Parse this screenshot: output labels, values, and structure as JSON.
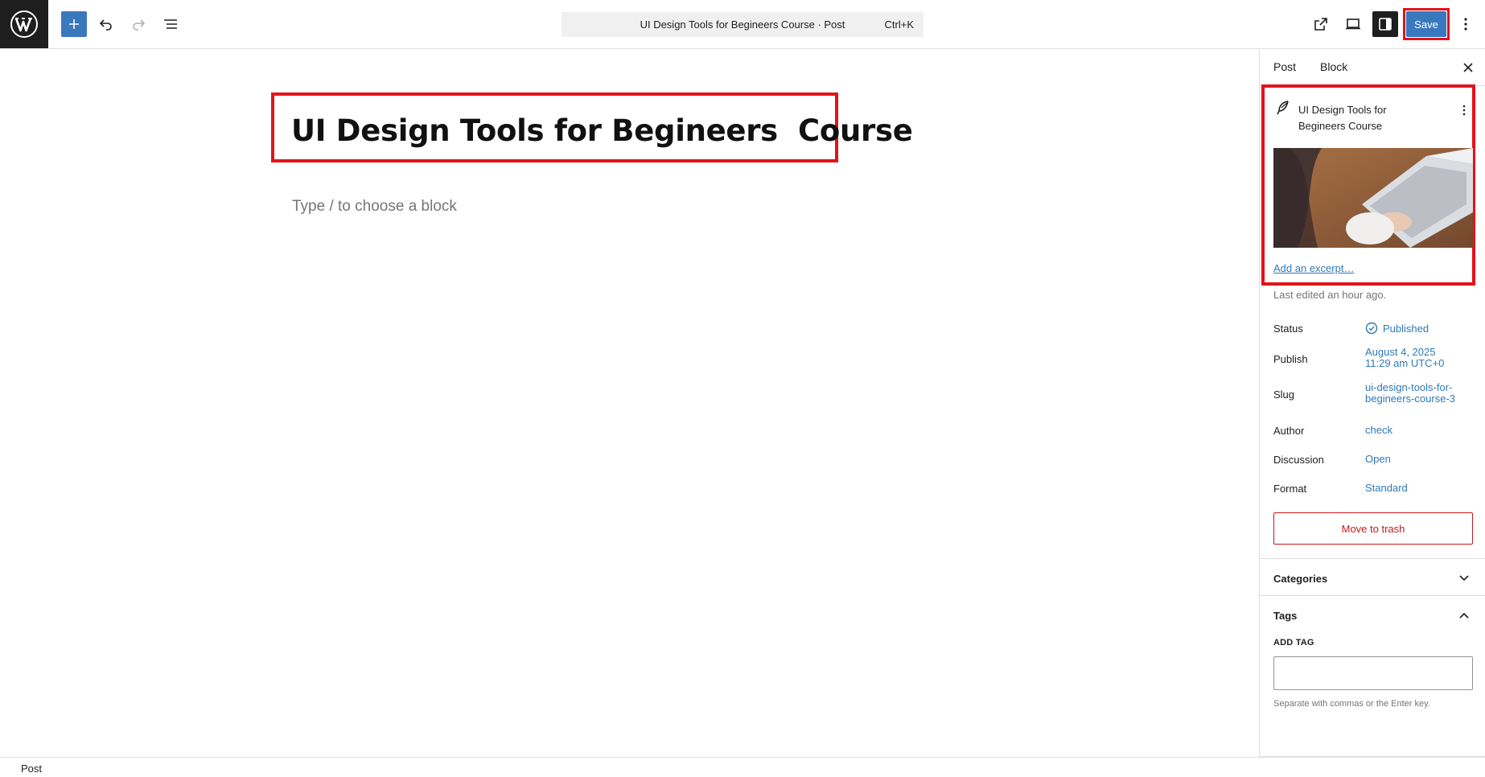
{
  "toolbar": {
    "logo_icon": "wordpress-logo",
    "inserter_icon": "plus-icon",
    "undo_icon": "undo-icon",
    "redo_icon": "redo-icon",
    "list_view_icon": "list-view-icon",
    "command_title": "UI Design Tools for Begineers Course · Post",
    "command_shortcut": "Ctrl+K",
    "view_post_icon": "external-link-icon",
    "preview_icon": "desktop-preview-icon",
    "settings_icon": "sidebar-toggle-icon",
    "save_label": "Save",
    "more_icon": "more-vertical-icon",
    "accent_color": "#3a78bd"
  },
  "editor": {
    "post_title": "UI Design Tools for Begineers  Course",
    "block_placeholder": "Type / to choose a block"
  },
  "sidebar": {
    "tabs": [
      "Post",
      "Block"
    ],
    "close_icon": "close-icon",
    "summary": {
      "post_icon": "post-feather-icon",
      "title": "UI Design Tools for Begineers Course",
      "featured_image_alt": "featured-image",
      "excerpt_link": "Add an excerpt…"
    },
    "last_edited": "Last edited an hour ago.",
    "meta": {
      "status_label": "Status",
      "status_value": "Published",
      "publish_label": "Publish",
      "publish_date": "August 4, 2025",
      "publish_time": "11:29 am UTC+0",
      "slug_label": "Slug",
      "slug_line1": "ui-design-tools-for-",
      "slug_line2": "begineers-course-3",
      "author_label": "Author",
      "author_value": "check",
      "discussion_label": "Discussion",
      "discussion_value": "Open",
      "format_label": "Format",
      "format_value": "Standard"
    },
    "trash_label": "Move to trash",
    "categories_title": "Categories",
    "tags_title": "Tags",
    "add_tag_label": "ADD TAG",
    "tag_help": "Separate with commas or the Enter key."
  },
  "footer": {
    "breadcrumb": "Post"
  }
}
